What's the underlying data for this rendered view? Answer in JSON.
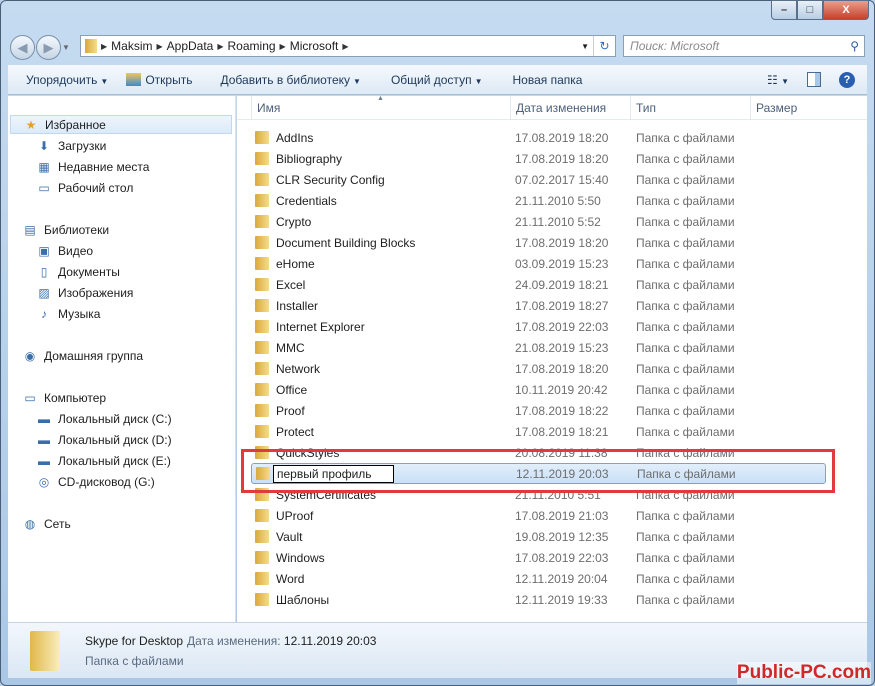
{
  "window": {
    "min": "–",
    "max": "□",
    "close": "X"
  },
  "address": {
    "segments": [
      "Maksim",
      "AppData",
      "Roaming",
      "Microsoft"
    ]
  },
  "search": {
    "placeholder": "Поиск: Microsoft"
  },
  "toolbar": {
    "organize": "Упорядочить",
    "open": "Открыть",
    "add_library": "Добавить в библиотеку",
    "share": "Общий доступ",
    "new_folder": "Новая папка"
  },
  "sidebar": {
    "items": [
      {
        "label": "Избранное",
        "icon": "star-icon"
      },
      {
        "label": "Загрузки",
        "icon": "downloads-icon"
      },
      {
        "label": "Недавние места",
        "icon": "recent-places-icon"
      },
      {
        "label": "Рабочий стол",
        "icon": "desktop-icon"
      },
      {
        "label": "Библиотеки",
        "icon": "libraries-icon"
      },
      {
        "label": "Видео",
        "icon": "video-icon"
      },
      {
        "label": "Документы",
        "icon": "documents-icon"
      },
      {
        "label": "Изображения",
        "icon": "pictures-icon"
      },
      {
        "label": "Музыка",
        "icon": "music-icon"
      },
      {
        "label": "Домашняя группа",
        "icon": "homegroup-icon"
      },
      {
        "label": "Компьютер",
        "icon": "computer-icon"
      },
      {
        "label": "Локальный диск (C:)",
        "icon": "drive-icon"
      },
      {
        "label": "Локальный диск (D:)",
        "icon": "drive-icon"
      },
      {
        "label": "Локальный диск (E:)",
        "icon": "drive-icon"
      },
      {
        "label": "CD-дисковод (G:)",
        "icon": "cd-drive-icon"
      },
      {
        "label": "Сеть",
        "icon": "network-icon"
      }
    ]
  },
  "columns": {
    "name": "Имя",
    "date": "Дата изменения",
    "type": "Тип",
    "size": "Размер"
  },
  "files": [
    {
      "name": "AddIns",
      "date": "17.08.2019 18:20",
      "type": "Папка с файлами"
    },
    {
      "name": "Bibliography",
      "date": "17.08.2019 18:20",
      "type": "Папка с файлами"
    },
    {
      "name": "CLR Security Config",
      "date": "07.02.2017 15:40",
      "type": "Папка с файлами"
    },
    {
      "name": "Credentials",
      "date": "21.11.2010 5:50",
      "type": "Папка с файлами"
    },
    {
      "name": "Crypto",
      "date": "21.11.2010 5:52",
      "type": "Папка с файлами"
    },
    {
      "name": "Document Building Blocks",
      "date": "17.08.2019 18:20",
      "type": "Папка с файлами"
    },
    {
      "name": "eHome",
      "date": "03.09.2019 15:23",
      "type": "Папка с файлами"
    },
    {
      "name": "Excel",
      "date": "24.09.2019 18:21",
      "type": "Папка с файлами"
    },
    {
      "name": "Installer",
      "date": "17.08.2019 18:27",
      "type": "Папка с файлами"
    },
    {
      "name": "Internet Explorer",
      "date": "17.08.2019 22:03",
      "type": "Папка с файлами"
    },
    {
      "name": "MMC",
      "date": "21.08.2019 15:23",
      "type": "Папка с файлами"
    },
    {
      "name": "Network",
      "date": "17.08.2019 18:20",
      "type": "Папка с файлами"
    },
    {
      "name": "Office",
      "date": "10.11.2019 20:42",
      "type": "Папка с файлами"
    },
    {
      "name": "Proof",
      "date": "17.08.2019 18:22",
      "type": "Папка с файлами"
    },
    {
      "name": "Protect",
      "date": "17.08.2019 18:21",
      "type": "Папка с файлами"
    },
    {
      "name": "QuickStyles",
      "date": "20.08.2019 11:38",
      "type": "Папка с файлами"
    },
    {
      "name": "первый профиль",
      "date": "12.11.2019 20:03",
      "type": "Папка с файлами",
      "selected": true
    },
    {
      "name": "SystemCertificates",
      "date": "21.11.2010 5:51",
      "type": "Папка с файлами"
    },
    {
      "name": "UProof",
      "date": "17.08.2019 21:03",
      "type": "Папка с файлами"
    },
    {
      "name": "Vault",
      "date": "19.08.2019 12:35",
      "type": "Папка с файлами"
    },
    {
      "name": "Windows",
      "date": "17.08.2019 22:03",
      "type": "Папка с файлами"
    },
    {
      "name": "Word",
      "date": "12.11.2019 20:04",
      "type": "Папка с файлами"
    },
    {
      "name": "Шаблоны",
      "date": "12.11.2019 19:33",
      "type": "Папка с файлами"
    }
  ],
  "status": {
    "name": "Skype for Desktop",
    "date_label": "Дата изменения:",
    "date": "12.11.2019 20:03",
    "type": "Папка с файлами"
  },
  "watermark": "Public-PC.com",
  "colors": {
    "highlight": "#e0393e"
  }
}
